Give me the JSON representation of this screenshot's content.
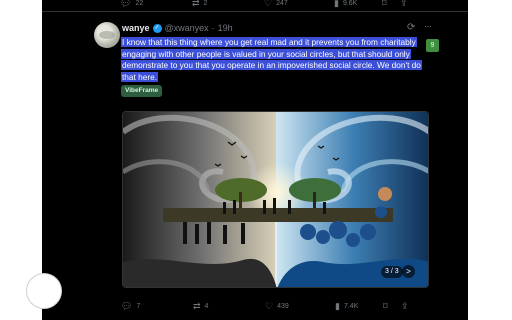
{
  "top_actions": {
    "replies": "22",
    "reposts": "2",
    "likes": "247",
    "views": "9.6K"
  },
  "tweet": {
    "author_name": "wanye",
    "handle": "@xwanyex",
    "dot": "·",
    "time": "19h",
    "text": "I know that this thing where you get real mad and it prevents you from charitably engaging with other people is valued in your social circles, but that should only demonstrate to you that you operate in an impoverished social circle. We don't do that here.",
    "badge_label": "VibeFrame",
    "side_badge": "9",
    "media_counter": "3 / 3",
    "next_label": ">"
  },
  "actions": {
    "replies": "7",
    "reposts": "4",
    "likes": "439",
    "views": "7.4K"
  },
  "icons": {
    "reply": "reply-icon",
    "repost": "repost-icon",
    "like": "heart-icon",
    "views": "views-icon",
    "bookmark": "bookmark-icon",
    "share": "share-icon",
    "grok": "grok-icon",
    "more": "more-icon"
  },
  "colors": {
    "background": "#000000",
    "selection": "#3b4fd8",
    "verified": "#1d9bf0",
    "muted": "#71767b",
    "badge": "#2d5e3e"
  }
}
